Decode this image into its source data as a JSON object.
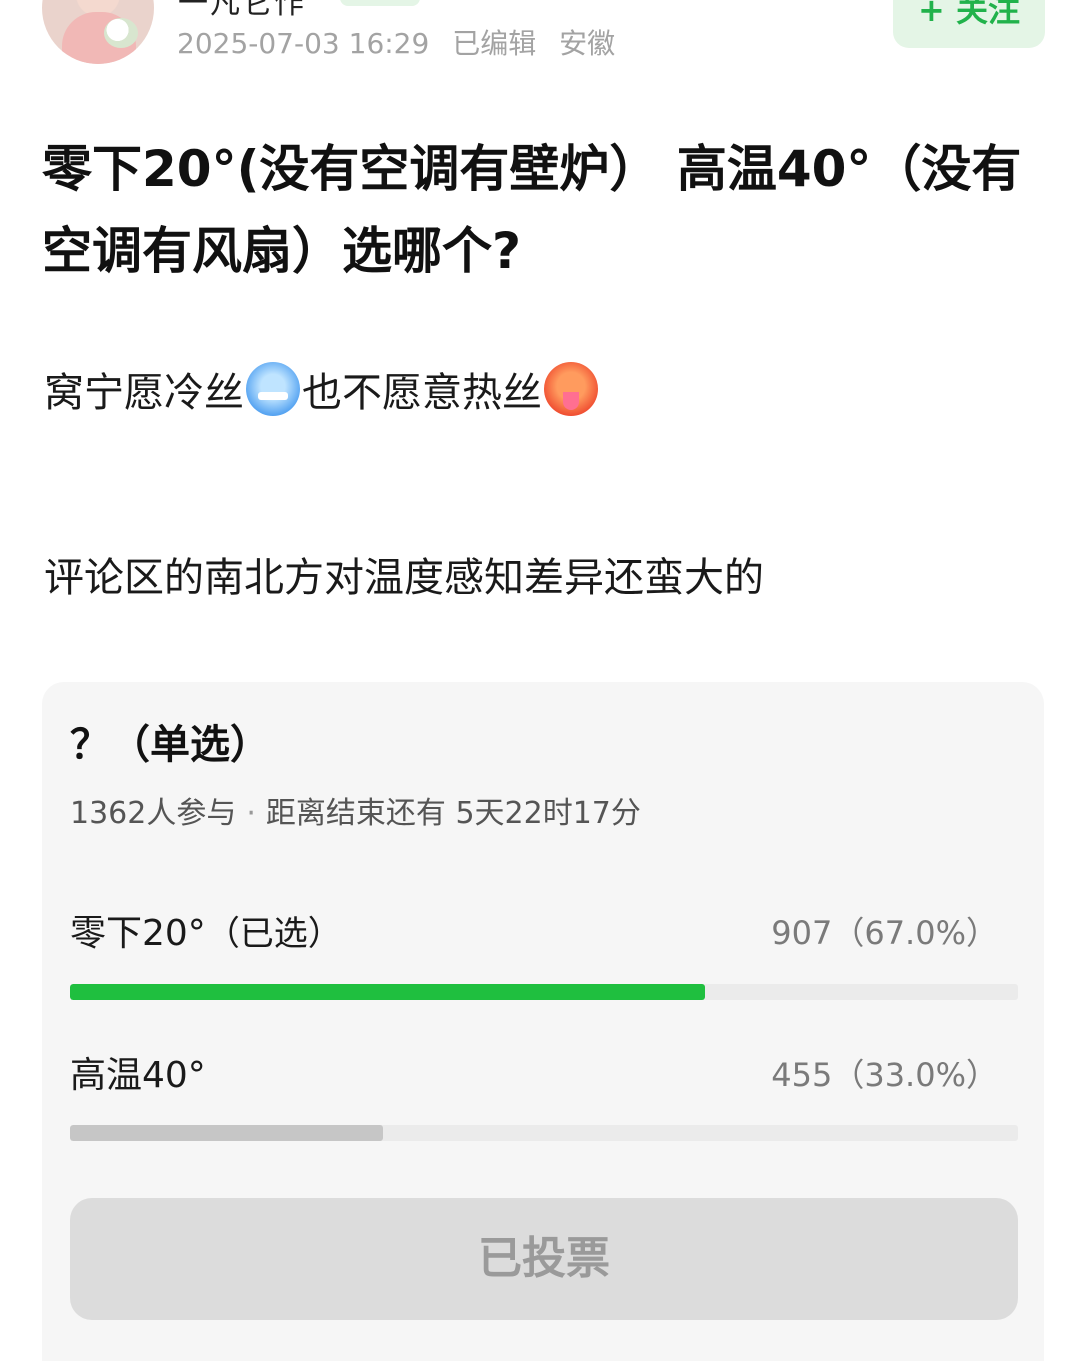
{
  "author": {
    "name": "一凡它作",
    "meta": {
      "date": "2025-07-03 16:29",
      "edited": "已编辑",
      "location": "安徽"
    },
    "follow_label": "+ 关注"
  },
  "post": {
    "title": "零下20°(没有空调有壁炉） 高温40°（没有空调有风扇）选哪个?",
    "para1_a": "窝宁愿冷丝",
    "para1_b": "也不愿意热丝",
    "para2": "评论区的南北方对温度感知差异还蛮大的"
  },
  "poll": {
    "title": "？（单选）",
    "participants": "1362人参与",
    "separator": "·",
    "remaining": "距离结束还有 5天22时17分",
    "options": [
      {
        "label": "零下20°",
        "tag": "（已选）",
        "count": "907（67.0%）",
        "fraction": 0.67
      },
      {
        "label": "高温40°",
        "tag": "",
        "count": "455（33.0%）",
        "fraction": 0.33
      }
    ],
    "vote_label": "已投票"
  },
  "icons": [
    "avatar",
    "cold-face-emoji",
    "hot-face-emoji"
  ],
  "colors": {
    "accent": "#21b24b",
    "bar_selected": "#1fbf3f",
    "bar_other": "#c6c6c6",
    "card_bg": "#f6f6f6"
  }
}
